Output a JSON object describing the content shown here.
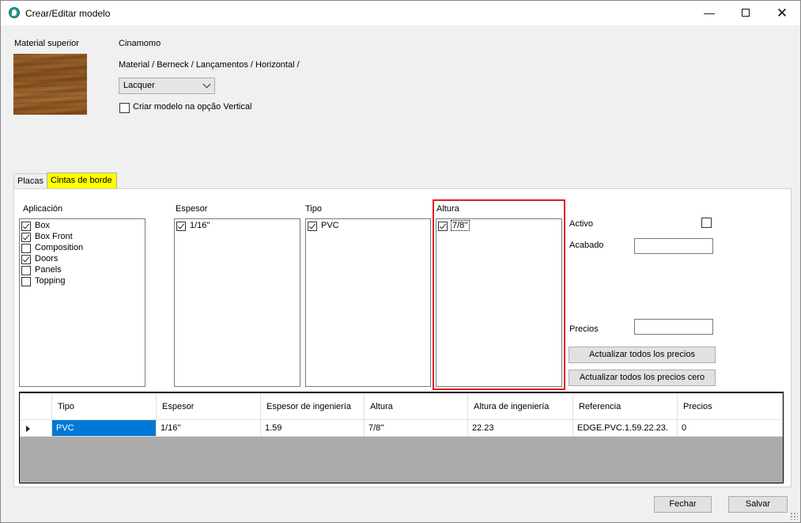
{
  "window": {
    "title": "Crear/Editar modelo"
  },
  "header": {
    "material_label": "Material superior",
    "material_name": "Cinamomo",
    "material_path": "Material / Berneck / Lançamentos / Horizontal /",
    "finish_select": "Lacquer",
    "vertical_option": {
      "label": "Criar modelo na opção  Vertical",
      "checked": false
    }
  },
  "tabs": [
    {
      "label": "Placas",
      "active": false
    },
    {
      "label": "Cintas de borde",
      "active": true,
      "highlight": "#ffff00"
    }
  ],
  "aplicacion": {
    "label": "Aplicación",
    "items": [
      {
        "label": "Box",
        "checked": true
      },
      {
        "label": "Box Front",
        "checked": true
      },
      {
        "label": "Composition",
        "checked": false
      },
      {
        "label": "Doors",
        "checked": true
      },
      {
        "label": "Panels",
        "checked": false
      },
      {
        "label": "Topping",
        "checked": false
      }
    ]
  },
  "espesor": {
    "label": "Espesor",
    "items": [
      {
        "label": "1/16''",
        "checked": true
      }
    ]
  },
  "tipo": {
    "label": "Tipo",
    "items": [
      {
        "label": "PVC",
        "checked": true
      }
    ]
  },
  "altura": {
    "label": "Altura",
    "items": [
      {
        "label": "7/8''",
        "checked": true
      }
    ],
    "highlight": "#e21b23"
  },
  "side": {
    "activo_label": "Activo",
    "activo_checked": false,
    "acabado_label": "Acabado",
    "acabado_value": "",
    "precios_label": "Precios",
    "precios_value": "",
    "btn_update_all": "Actualizar todos los precios",
    "btn_update_zero": "Actualizar todos los precios cero"
  },
  "grid": {
    "columns": [
      "Tipo",
      "Espesor",
      "Espesor de ingeniería",
      "Altura",
      "Altura de ingeniería",
      "Referencia",
      "Precios"
    ],
    "rows": [
      [
        "PVC",
        "1/16''",
        "1.59",
        "7/8''",
        "22.23",
        "EDGE.PVC.1.59.22.23.",
        "0"
      ]
    ]
  },
  "footer": {
    "close_label": "Fechar",
    "save_label": "Salvar"
  }
}
